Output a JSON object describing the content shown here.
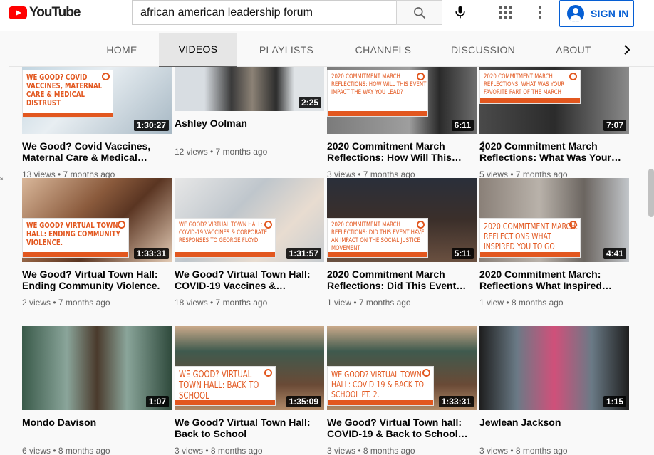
{
  "masthead": {
    "logo_text": "YouTube",
    "search_value": "african american leadership forum",
    "signin_label": "SIGN IN"
  },
  "tabs": [
    "HOME",
    "VIDEOS",
    "PLAYLISTS",
    "CHANNELS",
    "DISCUSSION",
    "ABOUT"
  ],
  "active_tab": "VIDEOS",
  "edge_text": "s",
  "colors": {
    "brand_red": "#ff0000",
    "accent_blue": "#065fd4",
    "overlay_orange": "#e2571f"
  },
  "icons": [
    "youtube-logo-icon",
    "search-icon",
    "microphone-icon",
    "apps-grid-icon",
    "more-vert-icon",
    "account-circle-icon",
    "chevron-right-icon"
  ],
  "videos": [
    {
      "title": "We Good? Covid Vaccines, Maternal Care & Medical…",
      "meta": "13 views • 7 months ago",
      "duration": "1:30:27",
      "overlay": "We Good? Covid Vaccines, Maternal Care & Medical Distrust"
    },
    {
      "title": "Ashley Oolman",
      "meta": "12 views • 7 months ago",
      "duration": "2:25",
      "overlay": ""
    },
    {
      "title": "2020 Commitment March Reflections: How Will This…",
      "meta": "3 views • 7 months ago",
      "duration": "6:11",
      "overlay": "2020 Commitment March Reflections: How will this event impact the way you lead?"
    },
    {
      "title": "2020 Commitment March Reflections: What Was Your…",
      "meta": "5 views • 7 months ago",
      "duration": "7:07",
      "overlay": "2020 Commitment March Reflections: What was your favorite part of the march"
    },
    {
      "title": "We Good? Virtual Town Hall: Ending Community Violence.",
      "meta": "2 views • 7 months ago",
      "duration": "1:33:31",
      "overlay": "We Good? Virtual Town Hall: Ending Community Violence."
    },
    {
      "title": "We Good? Virtual Town Hall: COVID-19 Vaccines &…",
      "meta": "18 views • 7 months ago",
      "duration": "1:31:57",
      "overlay": "We Good? Virtual Town Hall: COVID-19 Vaccines & Corporate Responses to George Floyd."
    },
    {
      "title": "2020 Commitment March Reflections: Did This Event…",
      "meta": "1 view • 7 months ago",
      "duration": "5:11",
      "overlay": "2020 Commitment March Reflections: Did this event have an impact on the social justice movement"
    },
    {
      "title": "2020 Commitment March: Reflections What Inspired…",
      "meta": "1 view • 8 months ago",
      "duration": "4:41",
      "overlay": "2020 Commitment March: Reflections What Inspired You to Go"
    },
    {
      "title": "Mondo Davison",
      "meta": "6 views • 8 months ago",
      "duration": "1:07",
      "overlay": ""
    },
    {
      "title": "We Good? Virtual Town Hall: Back to School",
      "meta": "3 views • 8 months ago",
      "duration": "1:35:09",
      "overlay": "We Good? Virtual Town Hall: Back to School"
    },
    {
      "title": "We Good? Virtual Town hall: COVID-19 & Back to School…",
      "meta": "3 views • 8 months ago",
      "duration": "1:33:31",
      "overlay": "We Good? Virtual Town Hall: COVID-19 & Back to School Pt. 2."
    },
    {
      "title": "Jewlean Jackson",
      "meta": "3 views • 8 months ago",
      "duration": "1:15",
      "overlay": ""
    }
  ]
}
